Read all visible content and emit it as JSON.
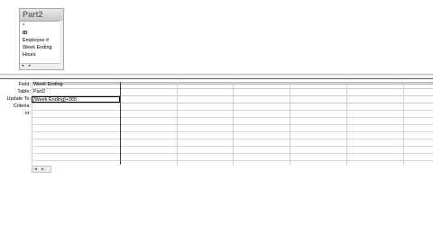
{
  "field_list": {
    "title": "Part2",
    "items": [
      {
        "label": "*"
      },
      {
        "label": "ID"
      },
      {
        "label": "Employee #"
      },
      {
        "label": "Week Ending"
      },
      {
        "label": "Hours"
      }
    ]
  },
  "grid": {
    "row_labels": {
      "field": "Field:",
      "table": "Table:",
      "update_to": "Update To:",
      "criteria": "Criteria:",
      "or": "or:"
    },
    "column1": {
      "field": "Week Ending",
      "table": "Part2",
      "update_to": "[Week Ending]+365"
    }
  },
  "scrollbar": {
    "left_arrow": "◂",
    "right_arrow": "▸"
  }
}
